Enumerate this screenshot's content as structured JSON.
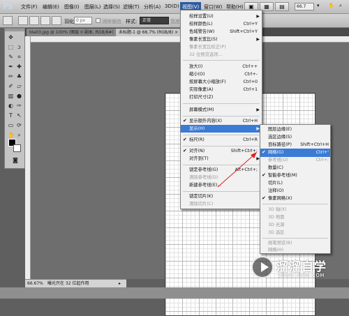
{
  "app": {
    "logo": "Ps"
  },
  "menubar": {
    "items": [
      {
        "label": "文件(F)"
      },
      {
        "label": "编辑(E)"
      },
      {
        "label": "图像(I)"
      },
      {
        "label": "图层(L)"
      },
      {
        "label": "选择(S)"
      },
      {
        "label": "滤镜(T)"
      },
      {
        "label": "分析(A)"
      },
      {
        "label": "3D(D)"
      },
      {
        "label": "视图(V)"
      },
      {
        "label": "窗口(W)"
      },
      {
        "label": "帮助(H)"
      }
    ],
    "active": "视图(V)",
    "zoom": "66.7"
  },
  "options": {
    "feather_label": "羽化:",
    "feather_value": "0 px",
    "antialias_label": "消除锯齿",
    "style_label": "样式:",
    "style_value": "正常",
    "width_label": "宽度"
  },
  "tabs": [
    {
      "label": "bla03.jpg @ 100% (图层 0 副本, RGB/8#) ×"
    },
    {
      "label": "未标题-1 @ 66.7% (RGB/8) ×"
    }
  ],
  "status": {
    "zoom": "66.67%",
    "message": "曝光只在 32 位起作用"
  },
  "view_menu": {
    "items": [
      {
        "label": "校样设置(U)",
        "shortcut": "",
        "submenu": true
      },
      {
        "label": "校样颜色(L)",
        "shortcut": "Ctrl+Y"
      },
      {
        "label": "色域警告(W)",
        "shortcut": "Shift+Ctrl+Y"
      },
      {
        "label": "像素长宽比(S)",
        "shortcut": "",
        "submenu": true
      },
      {
        "label": "像素长宽比校正(P)",
        "shortcut": "",
        "disabled": true
      },
      {
        "label": "32 位预览选项...",
        "shortcut": "",
        "disabled": true
      },
      {
        "label": "放大(I)",
        "shortcut": "Ctrl++"
      },
      {
        "label": "缩小(O)",
        "shortcut": "Ctrl+-"
      },
      {
        "label": "按屏幕大小缩放(F)",
        "shortcut": "Ctrl+0"
      },
      {
        "label": "实际像素(A)",
        "shortcut": "Ctrl+1"
      },
      {
        "label": "打印尺寸(Z)",
        "shortcut": ""
      },
      {
        "label": "屏幕模式(M)",
        "shortcut": "",
        "submenu": true
      },
      {
        "label": "显示额外内容(X)",
        "shortcut": "Ctrl+H",
        "checked": true
      },
      {
        "label": "显示(H)",
        "shortcut": "",
        "submenu": true,
        "highlight": true
      },
      {
        "label": "标尺(R)",
        "shortcut": "Ctrl+R",
        "checked": true
      },
      {
        "label": "对齐(N)",
        "shortcut": "Shift+Ctrl+;",
        "checked": true
      },
      {
        "label": "对齐到(T)",
        "shortcut": "",
        "submenu": true
      },
      {
        "label": "锁定参考线(G)",
        "shortcut": "Alt+Ctrl+;"
      },
      {
        "label": "清除参考线(D)",
        "shortcut": "",
        "disabled": true
      },
      {
        "label": "新建参考线(E)...",
        "shortcut": ""
      },
      {
        "label": "锁定切片(K)",
        "shortcut": ""
      },
      {
        "label": "清除切片(C)",
        "shortcut": "",
        "disabled": true
      }
    ]
  },
  "show_submenu": {
    "items": [
      {
        "label": "图层边缘(E)",
        "shortcut": ""
      },
      {
        "label": "选区边缘(S)",
        "shortcut": ""
      },
      {
        "label": "目标路径(P)",
        "shortcut": "Shift+Ctrl+H"
      },
      {
        "label": "网格(G)",
        "shortcut": "Ctrl+'",
        "checked": true,
        "highlight": true
      },
      {
        "label": "参考线(U)",
        "shortcut": "Ctrl+;",
        "disabled": true
      },
      {
        "label": "数量(C)",
        "shortcut": ""
      },
      {
        "label": "智能参考线(M)",
        "shortcut": "",
        "checked": true
      },
      {
        "label": "切片(L)",
        "shortcut": ""
      },
      {
        "label": "注释(O)",
        "shortcut": ""
      },
      {
        "label": "像素网格(X)",
        "shortcut": "",
        "checked": true
      },
      {
        "label": "3D 轴(X)",
        "shortcut": "",
        "disabled": true
      },
      {
        "label": "3D 地面",
        "shortcut": "",
        "disabled": true
      },
      {
        "label": "3D 光源",
        "shortcut": "",
        "disabled": true
      },
      {
        "label": "3D 选区",
        "shortcut": "",
        "disabled": true
      },
      {
        "label": "画笔预览(B)",
        "shortcut": "",
        "disabled": true
      },
      {
        "label": "网格(H)",
        "shortcut": "",
        "disabled": true
      }
    ]
  },
  "watermark": {
    "title": "溜溜自学",
    "url": "ZIXUE.3066.COM"
  },
  "colors": {
    "accent": "#3a7bd5",
    "menubar": "#c9c9c9",
    "canvas_bg": "#6e6e6e"
  }
}
